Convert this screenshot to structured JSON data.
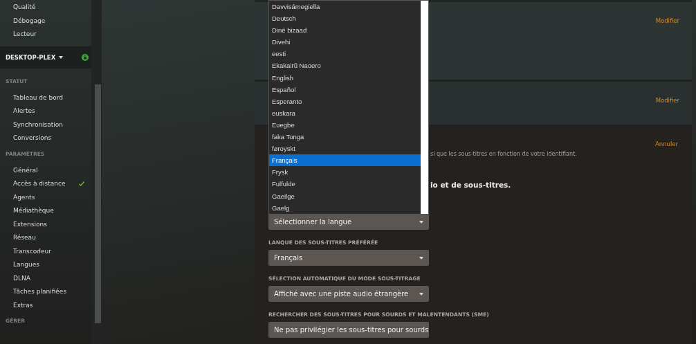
{
  "sidebar": {
    "top_items": [
      {
        "label": "Qualité"
      },
      {
        "label": "Débogage"
      },
      {
        "label": "Lecteur"
      }
    ],
    "server": {
      "name": "DESKTOP-PLEX",
      "secure": true
    },
    "sections": [
      {
        "title": "STATUT",
        "items": [
          {
            "label": "Tableau de bord",
            "checked": false
          },
          {
            "label": "Alertes",
            "checked": false
          },
          {
            "label": "Synchronisation",
            "checked": false
          },
          {
            "label": "Conversions",
            "checked": false
          }
        ]
      },
      {
        "title": "PARAMÈTRES",
        "items": [
          {
            "label": "Général",
            "checked": false
          },
          {
            "label": "Accès à distance",
            "checked": true
          },
          {
            "label": "Agents",
            "checked": false
          },
          {
            "label": "Médiathèque",
            "checked": false
          },
          {
            "label": "Extensions",
            "checked": false
          },
          {
            "label": "Réseau",
            "checked": false
          },
          {
            "label": "Transcodeur",
            "checked": false
          },
          {
            "label": "Langues",
            "checked": false
          },
          {
            "label": "DLNA",
            "checked": false
          },
          {
            "label": "Tâches planifiées",
            "checked": false
          },
          {
            "label": "Extras",
            "checked": false
          }
        ]
      },
      {
        "title": "GÉRER"
      }
    ]
  },
  "panels": [
    {
      "action": "Modifier"
    },
    {
      "action": "Modifier"
    }
  ],
  "active_panel": {
    "action": "Annuler",
    "description_fragment": "si que les sous-titres en fonction de votre identifiant.",
    "heading_fragment": "io et de sous-titres.",
    "language_list": [
      {
        "label": "Davvisámegiella",
        "selected": false
      },
      {
        "label": "Deutsch",
        "selected": false
      },
      {
        "label": "Diné bizaad",
        "selected": false
      },
      {
        "label": "Divehi",
        "selected": false
      },
      {
        "label": "eesti",
        "selected": false
      },
      {
        "label": "Ekakairũ Naoero",
        "selected": false
      },
      {
        "label": "English",
        "selected": false
      },
      {
        "label": "Español",
        "selected": false
      },
      {
        "label": "Esperanto",
        "selected": false
      },
      {
        "label": "euskara",
        "selected": false
      },
      {
        "label": "Eʋegbe",
        "selected": false
      },
      {
        "label": "faka Tonga",
        "selected": false
      },
      {
        "label": "føroyskt",
        "selected": false
      },
      {
        "label": "Français",
        "selected": true
      },
      {
        "label": "Frysk",
        "selected": false
      },
      {
        "label": "Fulfulde",
        "selected": false
      },
      {
        "label": "Gaeilge",
        "selected": false
      },
      {
        "label": "Gaelg",
        "selected": false
      }
    ],
    "fields": [
      {
        "value": "Sélectionner la langue"
      },
      {
        "label": "LANQUE DES SOUS-TITRES PRÉFÉRÉE",
        "value": "Français"
      },
      {
        "label": "SÉLECTION AUTOMATIQUE DU MODE SOUS-TITRAGE",
        "value": "Affiché avec une piste audio étrangère"
      },
      {
        "label": "RECHERCHER DES SOUS-TITRES POUR SOURDS ET MALENTENDANTS (SME)",
        "value": "Ne pas privilégier les sous-titres pour sourds"
      }
    ]
  }
}
